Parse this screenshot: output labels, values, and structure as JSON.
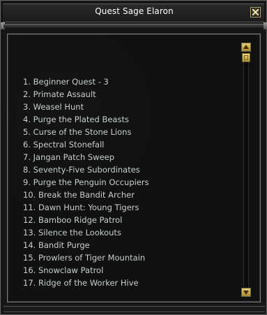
{
  "window": {
    "title": "Quest Sage Elaron",
    "close_icon": "close-x-icon",
    "accent_color": "#d9bf5a"
  },
  "quests": [
    {
      "label": "1. Beginner Quest - 3"
    },
    {
      "label": "2. Primate Assault"
    },
    {
      "label": "3. Weasel Hunt"
    },
    {
      "label": "4. Purge the Plated Beasts"
    },
    {
      "label": "5. Curse of the Stone Lions"
    },
    {
      "label": "6. Spectral Stonefall"
    },
    {
      "label": "7. Jangan Patch Sweep"
    },
    {
      "label": "8. Seventy-Five Subordinates"
    },
    {
      "label": "9. Purge the Penguin Occupiers"
    },
    {
      "label": "10. Break the Bandit Archer"
    },
    {
      "label": "11. Dawn Hunt: Young Tigers"
    },
    {
      "label": "12. Bamboo Ridge Patrol"
    },
    {
      "label": "13. Silence the Lookouts"
    },
    {
      "label": "14. Bandit Purge"
    },
    {
      "label": "15. Prowlers of Tiger Mountain"
    },
    {
      "label": "16. Snowclaw Patrol"
    },
    {
      "label": "17. Ridge of the Worker Hive"
    }
  ],
  "scrollbar": {
    "up_icon": "arrow-up-icon",
    "down_icon": "arrow-down-icon",
    "position": 0
  }
}
